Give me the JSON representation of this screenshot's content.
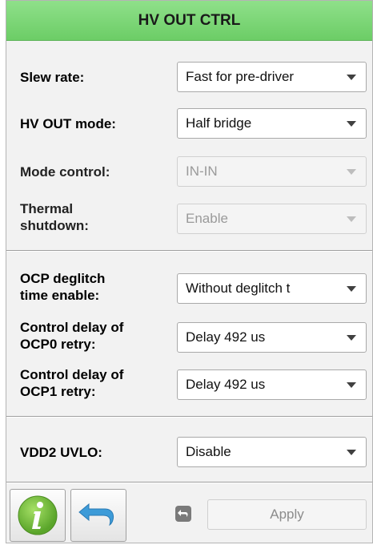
{
  "header": {
    "title": "HV OUT CTRL"
  },
  "settings": [
    {
      "label": "Slew rate:",
      "value": "Fast for pre-driver",
      "enabled": true
    },
    {
      "label": "HV OUT mode:",
      "value": "Half bridge",
      "enabled": true
    },
    {
      "label": "Mode control:",
      "value": "IN-IN",
      "enabled": false
    },
    {
      "label_line1": "Thermal",
      "label_line2": "shutdown:",
      "value": "Enable",
      "enabled": false
    }
  ],
  "ocp": [
    {
      "label_line1": "OCP deglitch",
      "label_line2": "time enable:",
      "value": "Without deglitch t",
      "enabled": true
    },
    {
      "label_line1": "Control delay of",
      "label_line2": "OCP0 retry:",
      "value": "Delay 492 us",
      "enabled": true
    },
    {
      "label_line1": "Control delay of",
      "label_line2": "OCP1 retry:",
      "value": "Delay 492 us",
      "enabled": true
    }
  ],
  "vdd": {
    "label": "VDD2 UVLO:",
    "value": "Disable",
    "enabled": true
  },
  "footer": {
    "info_icon": "info-icon",
    "back_icon": "back-arrow-icon",
    "undo_icon": "undo-icon",
    "apply_label": "Apply"
  },
  "colors": {
    "header_green": "#6ccd66",
    "info_green": "#7cc23f",
    "back_blue": "#3d9bd8"
  }
}
